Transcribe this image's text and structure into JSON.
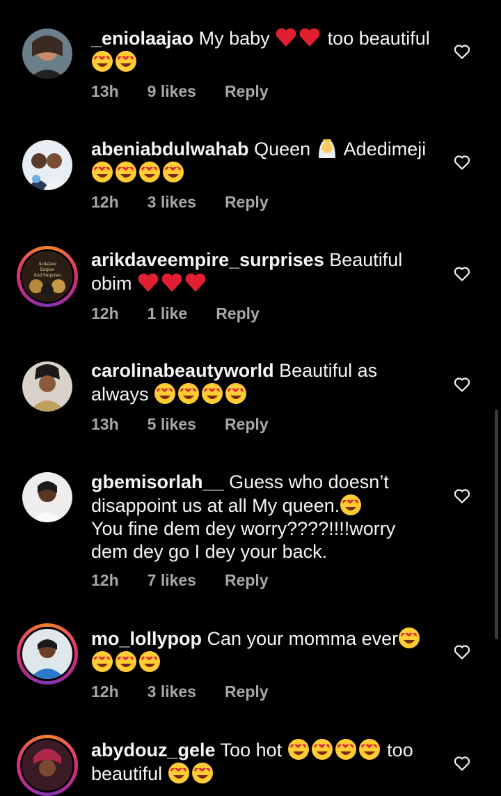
{
  "comments": [
    {
      "username": "_eniolaajao",
      "time": "13h",
      "likes": "9 likes",
      "reply": "Reply"
    },
    {
      "username": "abeniabdulwahab",
      "time": "12h",
      "likes": "3 likes",
      "reply": "Reply"
    },
    {
      "username": "arikdaveempire_surprises",
      "time": "12h",
      "likes": "1 like",
      "reply": "Reply"
    },
    {
      "username": "carolinabeautyworld",
      "time": "13h",
      "likes": "5 likes",
      "reply": "Reply"
    },
    {
      "username": "gbemisorlah__",
      "time": "12h",
      "likes": "7 likes",
      "reply": "Reply"
    },
    {
      "username": "mo_lollypop",
      "time": "12h",
      "likes": "3 likes",
      "reply": "Reply"
    },
    {
      "username": "abydouz_gele"
    }
  ],
  "texts": {
    "c1_a": "My baby",
    "c1_b": "too beautiful",
    "c2_a": "Queen",
    "c2_b": "Adedimeji",
    "c3_a": "Beautiful",
    "c3_b": "obim",
    "c4_a": "Beautiful as",
    "c4_b": "always",
    "c5_a": "Guess who doesn’t",
    "c5_b": "disappoint us at all My queen.",
    "c5_c": "You fine dem dey worry????!!!!worry",
    "c5_d": "dem dey go I dey your back.",
    "c6_a": "Can your momma ever",
    "c7_a": "Too hot",
    "c7_b": "too",
    "c7_c": "beautiful"
  },
  "avatar_text": {
    "arikdave": "Arikdave Empire And Surprises"
  },
  "icons": {
    "like": "heart-outline-icon",
    "emoji_love": "heart-eyes-emoji",
    "emoji_heart": "red-heart-emoji",
    "emoji_bride": "person-with-veil-emoji"
  },
  "colors": {
    "background": "#000000",
    "text": "#f5f5f5",
    "meta": "#a8a8a8",
    "story_ring": "#dd2a7b"
  }
}
